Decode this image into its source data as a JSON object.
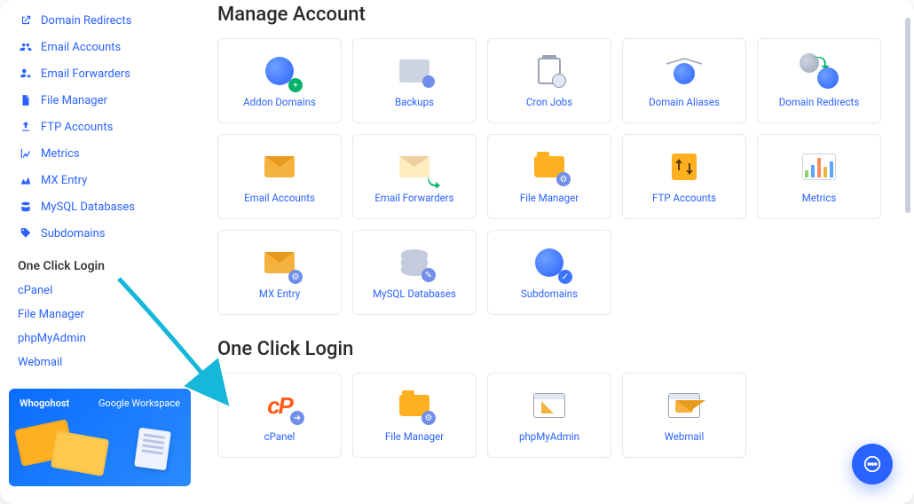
{
  "sidebar": {
    "manage_items": [
      {
        "icon": "redirect-icon",
        "label": "Domain Redirects"
      },
      {
        "icon": "users-icon",
        "label": "Email Accounts"
      },
      {
        "icon": "forward-icon",
        "label": "Email Forwarders"
      },
      {
        "icon": "file-icon",
        "label": "File Manager"
      },
      {
        "icon": "upload-icon",
        "label": "FTP Accounts"
      },
      {
        "icon": "chart-icon",
        "label": "Metrics"
      },
      {
        "icon": "mx-icon",
        "label": "MX Entry"
      },
      {
        "icon": "database-icon",
        "label": "MySQL Databases"
      },
      {
        "icon": "tag-icon",
        "label": "Subdomains"
      }
    ],
    "one_click_heading": "One Click Login",
    "one_click_items": [
      {
        "label": "cPanel"
      },
      {
        "label": "File Manager"
      },
      {
        "label": "phpMyAdmin"
      },
      {
        "label": "Webmail"
      }
    ],
    "promo": {
      "brand1": "Whogohost",
      "brand2": "Google Workspace"
    }
  },
  "sections": {
    "manage": {
      "title": "Manage Account",
      "tiles": [
        {
          "label": "Addon Domains",
          "icon": "addon-domains"
        },
        {
          "label": "Backups",
          "icon": "backups"
        },
        {
          "label": "Cron Jobs",
          "icon": "cron-jobs"
        },
        {
          "label": "Domain Aliases",
          "icon": "domain-aliases"
        },
        {
          "label": "Domain Redirects",
          "icon": "domain-redirects"
        },
        {
          "label": "Email Accounts",
          "icon": "email-accounts"
        },
        {
          "label": "Email Forwarders",
          "icon": "email-forwarders"
        },
        {
          "label": "File Manager",
          "icon": "file-manager"
        },
        {
          "label": "FTP Accounts",
          "icon": "ftp-accounts"
        },
        {
          "label": "Metrics",
          "icon": "metrics"
        },
        {
          "label": "MX Entry",
          "icon": "mx-entry"
        },
        {
          "label": "MySQL Databases",
          "icon": "mysql-databases"
        },
        {
          "label": "Subdomains",
          "icon": "subdomains"
        }
      ]
    },
    "login": {
      "title": "One Click Login",
      "tiles": [
        {
          "label": "cPanel",
          "icon": "cpanel"
        },
        {
          "label": "File Manager",
          "icon": "file-manager"
        },
        {
          "label": "phpMyAdmin",
          "icon": "phpmyadmin"
        },
        {
          "label": "Webmail",
          "icon": "webmail"
        }
      ]
    }
  }
}
